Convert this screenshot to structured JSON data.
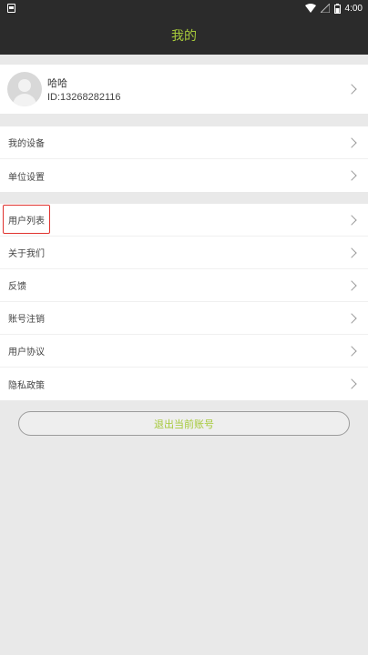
{
  "status_bar": {
    "time": "4:00"
  },
  "header": {
    "title": "我的"
  },
  "profile": {
    "name": "哈哈",
    "id": "ID:13268282116"
  },
  "group1": [
    {
      "label": "我的设备"
    },
    {
      "label": "单位设置"
    }
  ],
  "group2": [
    {
      "label": "用户列表"
    },
    {
      "label": "关于我们"
    },
    {
      "label": "反馈"
    },
    {
      "label": "账号注销"
    },
    {
      "label": "用户协议"
    },
    {
      "label": "隐私政策"
    }
  ],
  "logout": {
    "label": "退出当前账号"
  },
  "colors": {
    "accent": "#a6c93a",
    "highlight": "#e0322e",
    "bar": "#2b2b2b"
  }
}
